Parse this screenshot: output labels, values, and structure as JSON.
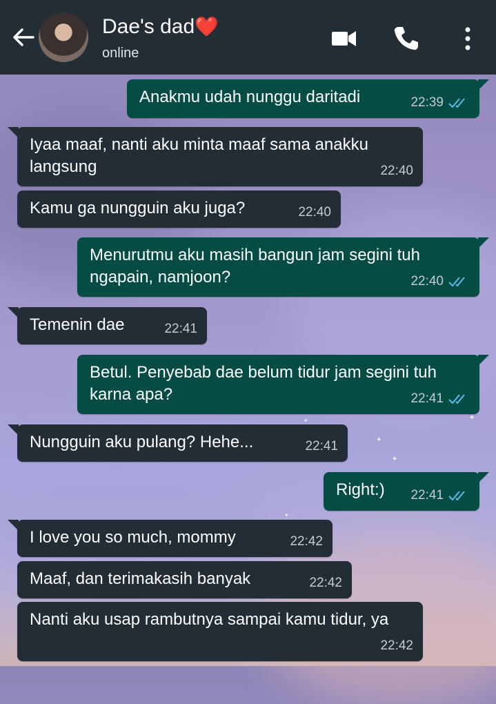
{
  "header": {
    "contact_name": "Dae's dad",
    "heart": "❤️",
    "status": "online",
    "icons": [
      "back-arrow-icon",
      "video-call-icon",
      "phone-icon",
      "more-vert-icon"
    ]
  },
  "colors": {
    "header_bg": "#232d36",
    "incoming_bubble": "#232d36",
    "outgoing_bubble": "#054c44",
    "read_ticks": "#53bdeb"
  },
  "messages": [
    {
      "dir": "out",
      "text": "Anakmu udah nunggu daritadi",
      "time": "22:39",
      "read": true
    },
    {
      "dir": "in",
      "text": "Iyaa maaf, nanti aku minta maaf sama anakku langsung",
      "time": "22:40"
    },
    {
      "dir": "in",
      "text": "Kamu ga nungguin aku juga?",
      "time": "22:40"
    },
    {
      "dir": "out",
      "text": "Menurutmu aku masih bangun jam segini tuh ngapain, namjoon?",
      "time": "22:40",
      "read": true
    },
    {
      "dir": "in",
      "text": "Temenin dae",
      "time": "22:41"
    },
    {
      "dir": "out",
      "text": "Betul. Penyebab dae belum tidur jam segini tuh karna apa?",
      "time": "22:41",
      "read": true
    },
    {
      "dir": "in",
      "text": "Nungguin aku pulang? Hehe...",
      "time": "22:41"
    },
    {
      "dir": "out",
      "text": "Right:)",
      "time": "22:41",
      "read": true
    },
    {
      "dir": "in",
      "text": "I love you so much, mommy",
      "time": "22:42"
    },
    {
      "dir": "in",
      "text": "Maaf, dan terimakasih banyak",
      "time": "22:42"
    },
    {
      "dir": "in",
      "text": "Nanti aku usap rambutnya sampai kamu tidur, ya",
      "time": "22:42"
    }
  ]
}
